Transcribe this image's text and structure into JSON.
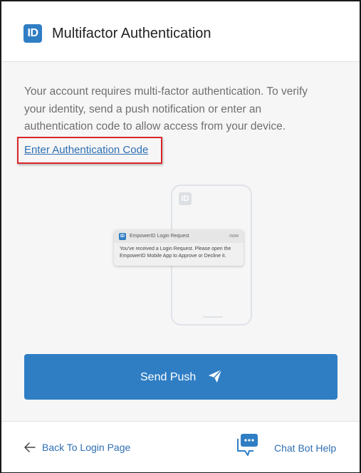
{
  "header": {
    "logo_text": "ID",
    "title": "Multifactor Authentication"
  },
  "main": {
    "description": "Your account requires multi-factor authentication. To verify your identity, send a push notification or enter an authentication code to allow access from your device.",
    "auth_code_link": "Enter Authentication Code",
    "illustration": {
      "phone_logo_text": "ID",
      "notification": {
        "app_name": "EmpowerID Login Request",
        "time": "now",
        "message": "You've received a Login Request. Please open the EmpowerID Mobile App to Approve or Decline it."
      }
    },
    "send_push_label": "Send Push"
  },
  "footer": {
    "back_label": "Back To Login Page",
    "chat_label": "Chat Bot Help"
  },
  "colors": {
    "accent": "#2f7ec4",
    "link": "#2f6fb3",
    "highlight_border": "#d9262a",
    "body_bg": "#f6f6f6"
  },
  "icons": [
    "empowerid-logo-icon",
    "paper-plane-icon",
    "arrow-left-icon",
    "chat-bubble-icon"
  ]
}
